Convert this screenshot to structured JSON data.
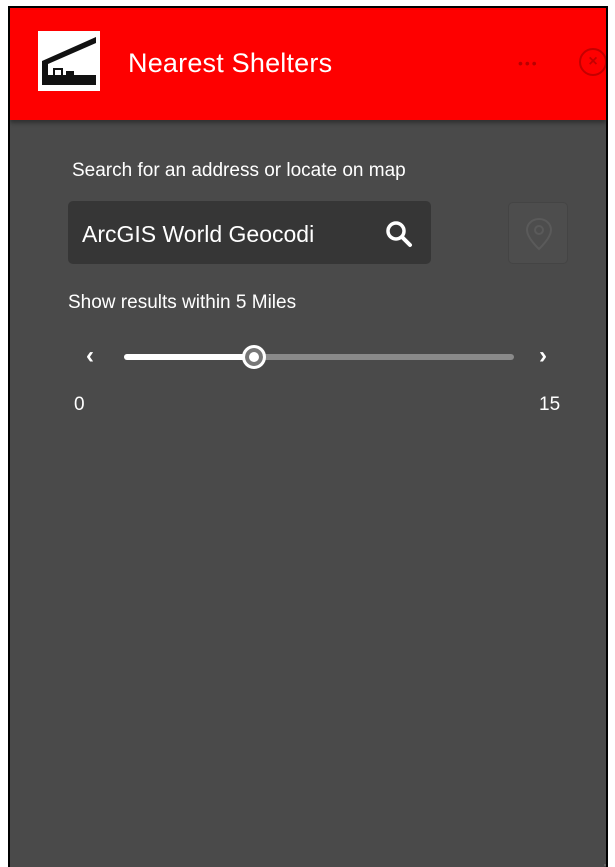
{
  "header": {
    "title": "Nearest Shelters",
    "more_icon": "more-dots-icon",
    "close_icon": "close-circle-icon",
    "logo_icon": "shelter-logo-icon",
    "colors": {
      "header_bg": "#fe0000",
      "panel_bg": "#4a4a4a"
    }
  },
  "search": {
    "label": "Search for an address or locate on map",
    "value": "ArcGIS World Geocodi",
    "search_icon": "search-icon",
    "locate_icon": "locate-pin-icon"
  },
  "range": {
    "label": "Show results within 5 Miles",
    "min_label": "0",
    "max_label": "15",
    "min": 0,
    "max": 15,
    "value": 5,
    "prev_icon": "chevron-left-icon",
    "next_icon": "chevron-right-icon"
  }
}
